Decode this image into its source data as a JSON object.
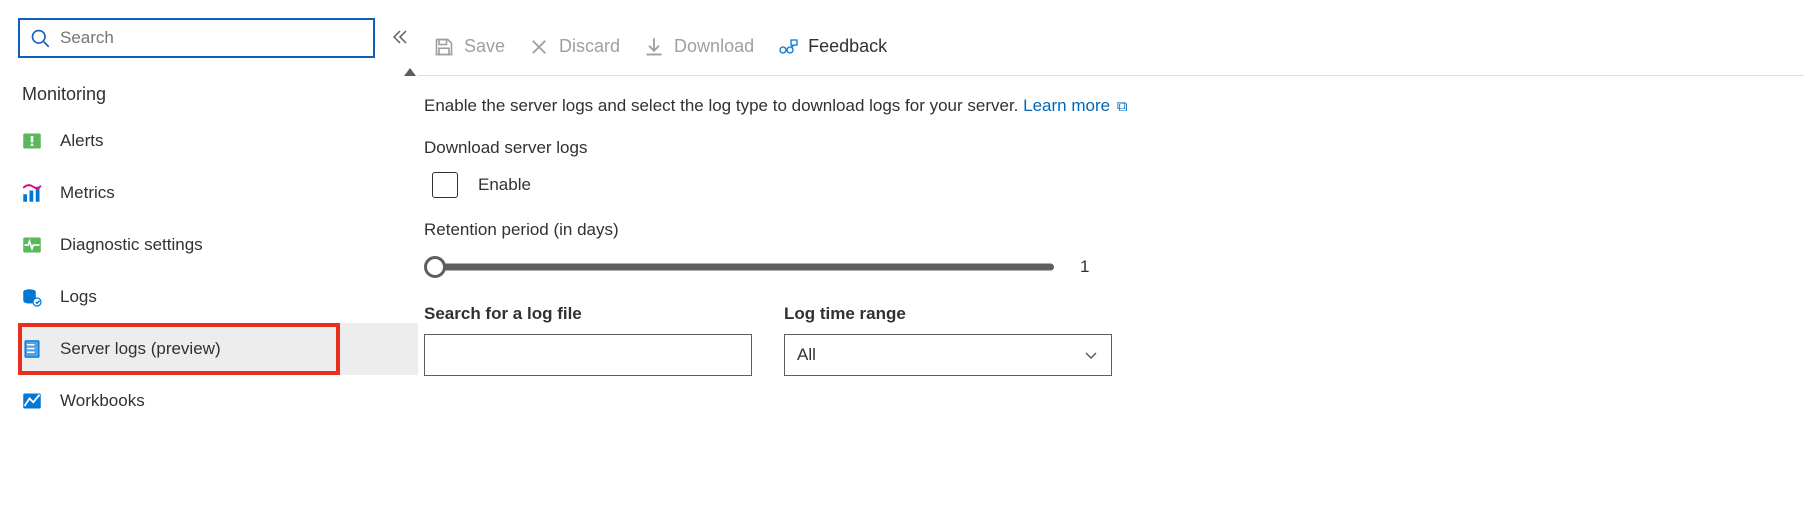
{
  "sidebar": {
    "search_placeholder": "Search",
    "section_heading": "Monitoring",
    "items": [
      {
        "label": "Alerts"
      },
      {
        "label": "Metrics"
      },
      {
        "label": "Diagnostic settings"
      },
      {
        "label": "Logs"
      },
      {
        "label": "Server logs (preview)"
      },
      {
        "label": "Workbooks"
      }
    ]
  },
  "toolbar": {
    "save": "Save",
    "discard": "Discard",
    "download": "Download",
    "feedback": "Feedback"
  },
  "desc": {
    "text": "Enable the server logs and select the log type to download logs for your server.",
    "link": "Learn more"
  },
  "form": {
    "download_label": "Download server logs",
    "enable_label": "Enable",
    "retention_label": "Retention period (in days)",
    "retention_value": "1",
    "search_label": "Search for a log file",
    "search_value": "",
    "timerange_label": "Log time range",
    "timerange_value": "All"
  }
}
